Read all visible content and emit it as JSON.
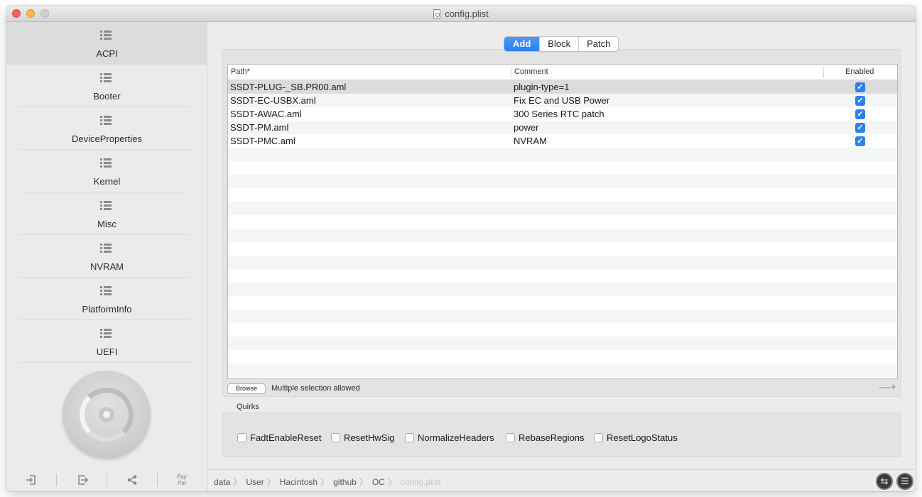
{
  "window": {
    "title": "config.plist"
  },
  "sidebar": {
    "items": [
      {
        "label": "ACPI",
        "active": true
      },
      {
        "label": "Booter"
      },
      {
        "label": "DeviceProperties"
      },
      {
        "label": "Kernel"
      },
      {
        "label": "Misc"
      },
      {
        "label": "NVRAM"
      },
      {
        "label": "PlatformInfo"
      },
      {
        "label": "UEFI"
      }
    ],
    "bottom": {
      "paypal_line1": "Pay",
      "paypal_line2": "Pal"
    }
  },
  "segments": {
    "add": "Add",
    "block": "Block",
    "patch": "Patch",
    "selected": "Add"
  },
  "table": {
    "headers": {
      "path": "Path*",
      "comment": "Comment",
      "enabled": "Enabled"
    },
    "rows": [
      {
        "path": "SSDT-PLUG-_SB.PR00.aml",
        "comment": "plugin-type=1",
        "enabled": true
      },
      {
        "path": "SSDT-EC-USBX.aml",
        "comment": "Fix EC and USB Power",
        "enabled": true
      },
      {
        "path": "SSDT-AWAC.aml",
        "comment": "300 Series RTC patch",
        "enabled": true
      },
      {
        "path": "SSDT-PM.aml",
        "comment": "power",
        "enabled": true
      },
      {
        "path": "SSDT-PMC.aml",
        "comment": "NVRAM",
        "enabled": true
      }
    ]
  },
  "table_footer": {
    "browse": "Browse",
    "multi_note": "Multiple selection allowed",
    "minus": "—",
    "plus": "+"
  },
  "quirks": {
    "label": "Quirks",
    "items": [
      {
        "label": "FadtEnableReset",
        "checked": false
      },
      {
        "label": "ResetHwSig",
        "checked": false
      },
      {
        "label": "NormalizeHeaders",
        "checked": false
      },
      {
        "label": "RebaseRegions",
        "checked": false
      },
      {
        "label": "ResetLogoStatus",
        "checked": false
      }
    ]
  },
  "breadcrumb": [
    "data",
    "User",
    "Hacintosh",
    "github",
    "OC",
    "config.plist"
  ],
  "colors": {
    "accent": "#2f80ed",
    "sidebar_active": "#dcdcdc"
  }
}
